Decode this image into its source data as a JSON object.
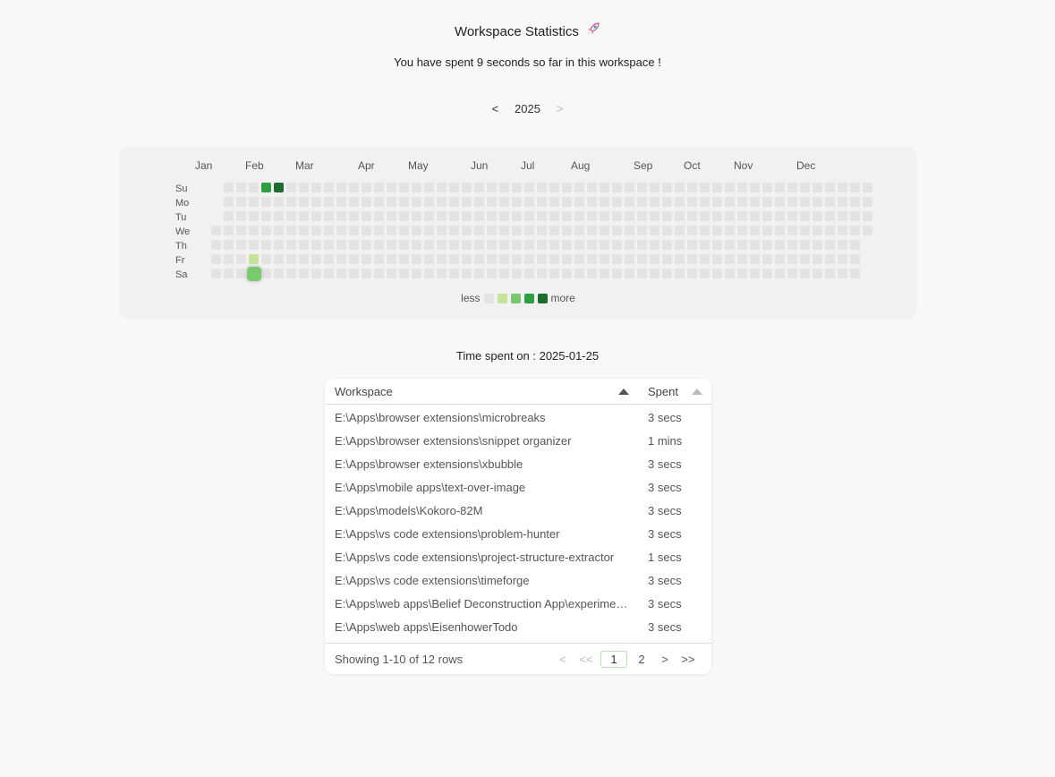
{
  "header": {
    "title": "Workspace Statistics",
    "title_icon": "rocket-icon",
    "subtitle": "You have spent 9 seconds so far in this workspace !"
  },
  "year_nav": {
    "prev": "<",
    "year": "2025",
    "next": ">"
  },
  "heatmap": {
    "months": [
      "Jan",
      "Feb",
      "Mar",
      "Apr",
      "May",
      "Jun",
      "Jul",
      "Aug",
      "Sep",
      "Oct",
      "Nov",
      "Dec"
    ],
    "days": [
      "Su",
      "Mo",
      "Tu",
      "We",
      "Th",
      "Fr",
      "Sa"
    ],
    "legend_less": "less",
    "legend_more": "more",
    "colors": [
      "#e3e3e3",
      "#c5e49a",
      "#7bc96f",
      "#2e9e44",
      "#1d6b2e"
    ],
    "active": [
      {
        "date": "2025-01-24",
        "level": 1
      },
      {
        "date": "2025-01-25",
        "level": 2
      },
      {
        "date": "2025-01-26",
        "level": 3
      },
      {
        "date": "2025-02-02",
        "level": 4
      }
    ],
    "selected_date": "2025-01-25"
  },
  "time_spent": {
    "label": "Time spent on : 2025-01-25"
  },
  "table": {
    "col_workspace": "Workspace",
    "col_spent": "Spent",
    "rows": [
      {
        "workspace": "E:\\Apps\\browser extensions\\microbreaks",
        "spent": "3 secs"
      },
      {
        "workspace": "E:\\Apps\\browser extensions\\snippet organizer",
        "spent": "1 mins"
      },
      {
        "workspace": "E:\\Apps\\browser extensions\\xbubble",
        "spent": "3 secs"
      },
      {
        "workspace": "E:\\Apps\\mobile apps\\text-over-image",
        "spent": "3 secs"
      },
      {
        "workspace": "E:\\Apps\\models\\Kokoro-82M",
        "spent": "3 secs"
      },
      {
        "workspace": "E:\\Apps\\vs code extensions\\problem-hunter",
        "spent": "3 secs"
      },
      {
        "workspace": "E:\\Apps\\vs code extensions\\project-structure-extractor",
        "spent": "1 secs"
      },
      {
        "workspace": "E:\\Apps\\vs code extensions\\timeforge",
        "spent": "3 secs"
      },
      {
        "workspace": "E:\\Apps\\web apps\\Belief Deconstruction App\\experiments",
        "spent": "3 secs"
      },
      {
        "workspace": "E:\\Apps\\web apps\\EisenhowerTodo",
        "spent": "3 secs"
      }
    ],
    "footer_info": "Showing 1-10 of 12 rows",
    "pager": {
      "prev": "<",
      "first": "<<",
      "pages": [
        "1",
        "2"
      ],
      "current": "1",
      "next": ">",
      "last": ">>"
    }
  }
}
